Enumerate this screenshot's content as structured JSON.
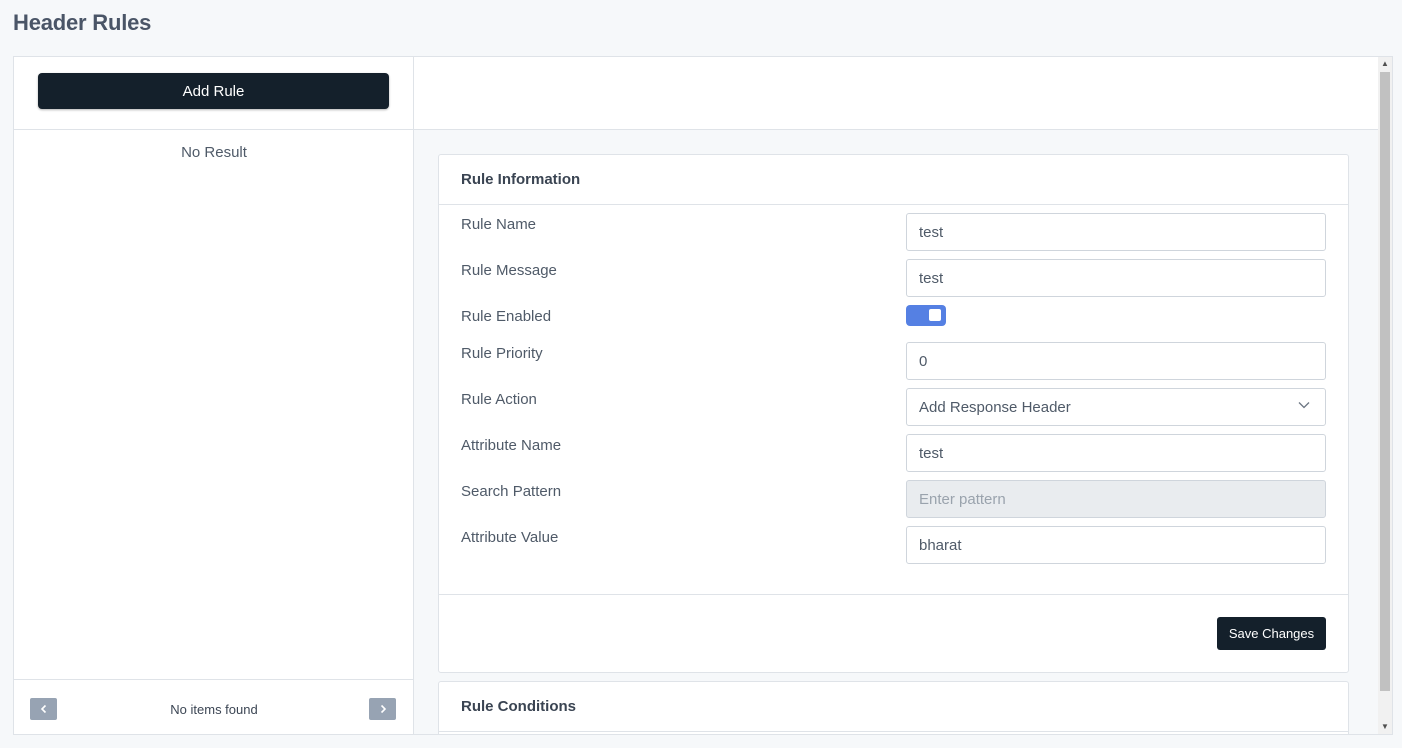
{
  "page": {
    "title": "Header Rules"
  },
  "left": {
    "add_rule_label": "Add Rule",
    "empty_text": "No Result",
    "footer": {
      "prev_icon": "chevron-left-icon",
      "next_icon": "chevron-right-icon",
      "status_text": "No items found"
    }
  },
  "rule_info": {
    "header": "Rule Information",
    "fields": {
      "rule_name": {
        "label": "Rule Name",
        "value": "test"
      },
      "rule_message": {
        "label": "Rule Message",
        "value": "test"
      },
      "rule_enabled": {
        "label": "Rule Enabled",
        "value": true
      },
      "rule_priority": {
        "label": "Rule Priority",
        "value": "0"
      },
      "rule_action": {
        "label": "Rule Action",
        "value": "Add Response Header"
      },
      "attribute_name": {
        "label": "Attribute Name",
        "value": "test"
      },
      "search_pattern": {
        "label": "Search Pattern",
        "value": "",
        "placeholder": "Enter pattern",
        "disabled": true
      },
      "attribute_value": {
        "label": "Attribute Value",
        "value": "bharat"
      }
    },
    "save_label": "Save Changes"
  },
  "rule_conditions": {
    "header": "Rule Conditions"
  },
  "colors": {
    "primary_button": "#14202b",
    "toggle_on": "#5580e3",
    "pager_button": "#97a3b3"
  }
}
